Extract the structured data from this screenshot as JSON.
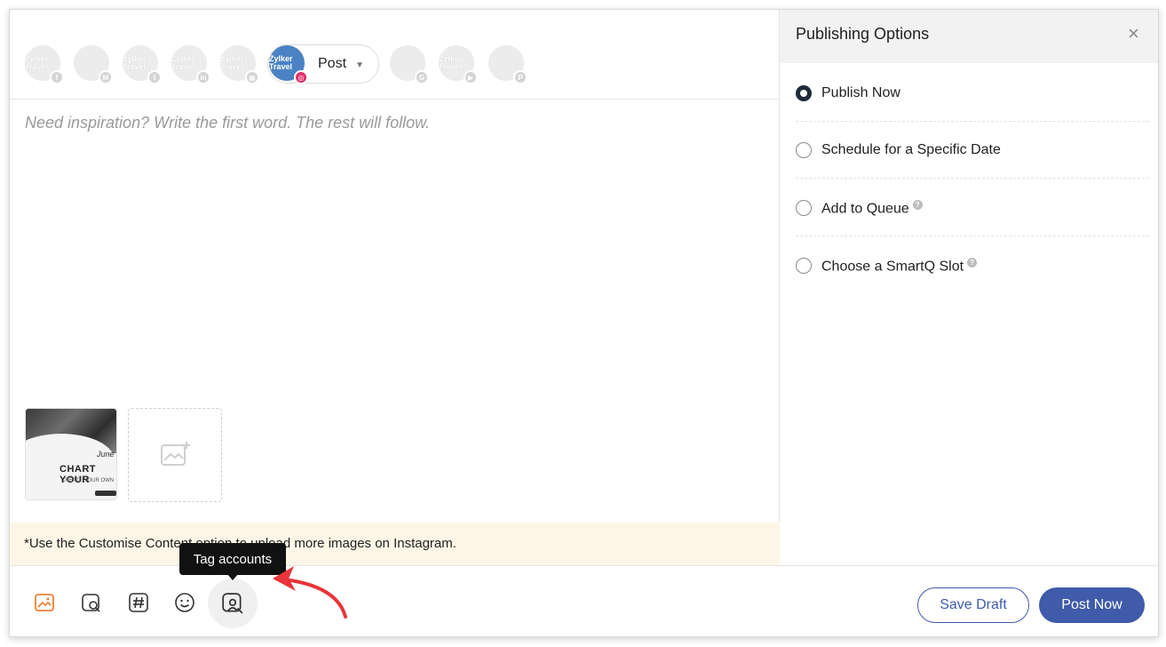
{
  "accounts": [
    {
      "label": "Zylker Travel",
      "network": "f",
      "network_name": "facebook"
    },
    {
      "label": "",
      "network": "M",
      "network_name": "google-my-business"
    },
    {
      "label": "Zylker Travel",
      "network": "t",
      "network_name": "twitter"
    },
    {
      "label": "Zylker Travel",
      "network": "in",
      "network_name": "linkedin"
    },
    {
      "label": "Zylker Travel",
      "network": "▦",
      "network_name": "linkedin-page"
    },
    {
      "label": "Zylker Travel",
      "network": "◎",
      "network_name": "instagram",
      "active": true
    },
    {
      "label": "",
      "network": "G",
      "network_name": "google"
    },
    {
      "label": "Zylker Travel",
      "network": "▶",
      "network_name": "youtube"
    },
    {
      "label": "",
      "network": "P",
      "network_name": "pinterest"
    }
  ],
  "post_type": {
    "label": "Post"
  },
  "editor": {
    "placeholder": "Need inspiration? Write the first word. The rest will follow."
  },
  "media": {
    "thumb_script": "June",
    "thumb_title": "CHART YOUR",
    "thumb_subtitle": "CREATE YOUR OWN"
  },
  "notice": {
    "text": "*Use the Customise Content option to upload more images on Instagram."
  },
  "tooltip": {
    "text": "Tag accounts"
  },
  "toolbar": {
    "tools": [
      "image-icon",
      "media-library-icon",
      "hashtag-icon",
      "emoji-icon",
      "tag-accounts-icon"
    ],
    "save_draft": "Save Draft",
    "post_now": "Post Now"
  },
  "panel": {
    "title": "Publishing Options",
    "close": "×",
    "options": [
      {
        "label": "Publish Now",
        "selected": true,
        "help": false
      },
      {
        "label": "Schedule for a Specific Date",
        "selected": false,
        "help": false
      },
      {
        "label": "Add to Queue",
        "selected": false,
        "help": true
      },
      {
        "label": "Choose a SmartQ Slot",
        "selected": false,
        "help": true
      }
    ],
    "help_glyph": "?"
  },
  "colors": {
    "primary": "#3f5ba9",
    "notice_bg": "#fdf6e6",
    "instagram": "#e1306c",
    "arrow": "#e8343a",
    "image_tool": "#e8823a"
  }
}
